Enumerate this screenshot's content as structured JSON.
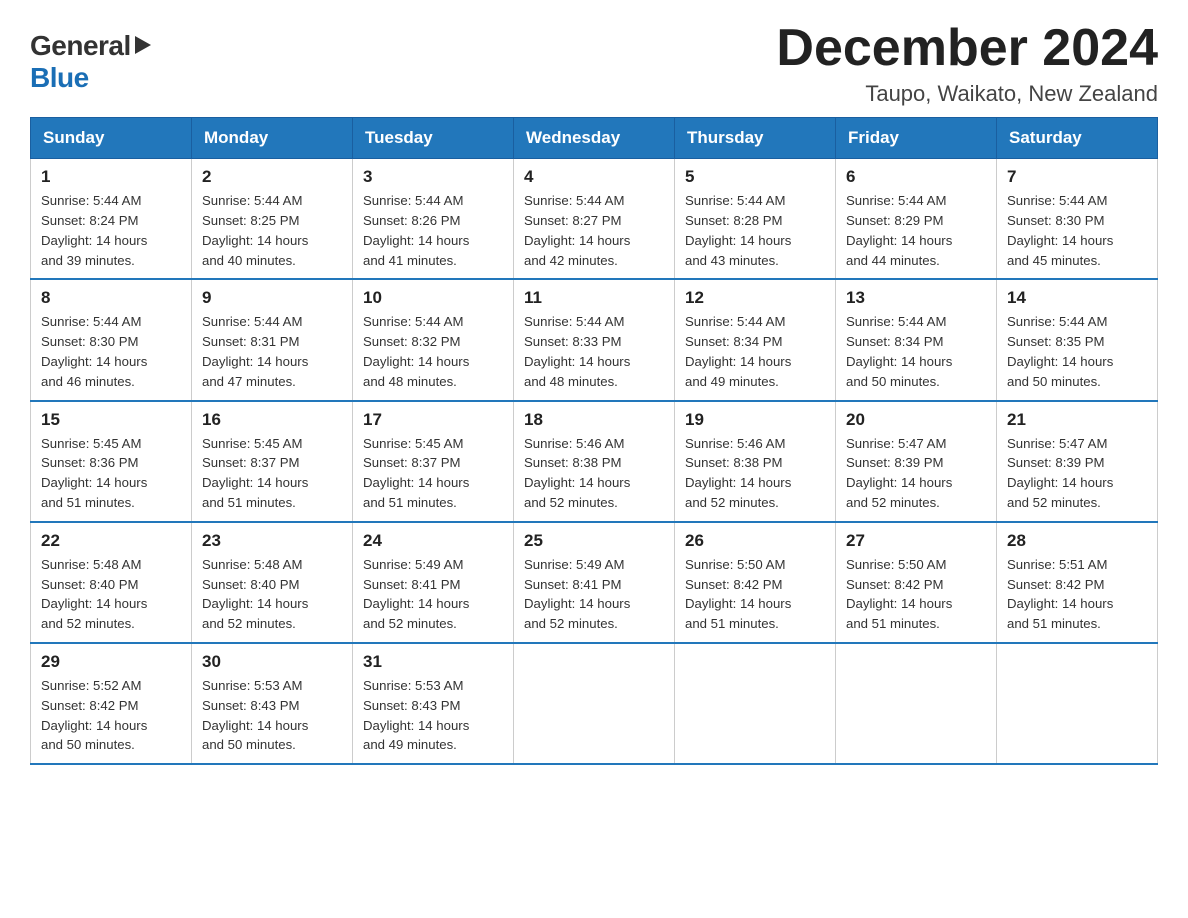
{
  "logo": {
    "general": "General",
    "blue": "Blue"
  },
  "title": {
    "month_year": "December 2024",
    "location": "Taupo, Waikato, New Zealand"
  },
  "headers": [
    "Sunday",
    "Monday",
    "Tuesday",
    "Wednesday",
    "Thursday",
    "Friday",
    "Saturday"
  ],
  "weeks": [
    [
      {
        "day": "1",
        "sunrise": "Sunrise: 5:44 AM",
        "sunset": "Sunset: 8:24 PM",
        "daylight": "Daylight: 14 hours and 39 minutes."
      },
      {
        "day": "2",
        "sunrise": "Sunrise: 5:44 AM",
        "sunset": "Sunset: 8:25 PM",
        "daylight": "Daylight: 14 hours and 40 minutes."
      },
      {
        "day": "3",
        "sunrise": "Sunrise: 5:44 AM",
        "sunset": "Sunset: 8:26 PM",
        "daylight": "Daylight: 14 hours and 41 minutes."
      },
      {
        "day": "4",
        "sunrise": "Sunrise: 5:44 AM",
        "sunset": "Sunset: 8:27 PM",
        "daylight": "Daylight: 14 hours and 42 minutes."
      },
      {
        "day": "5",
        "sunrise": "Sunrise: 5:44 AM",
        "sunset": "Sunset: 8:28 PM",
        "daylight": "Daylight: 14 hours and 43 minutes."
      },
      {
        "day": "6",
        "sunrise": "Sunrise: 5:44 AM",
        "sunset": "Sunset: 8:29 PM",
        "daylight": "Daylight: 14 hours and 44 minutes."
      },
      {
        "day": "7",
        "sunrise": "Sunrise: 5:44 AM",
        "sunset": "Sunset: 8:30 PM",
        "daylight": "Daylight: 14 hours and 45 minutes."
      }
    ],
    [
      {
        "day": "8",
        "sunrise": "Sunrise: 5:44 AM",
        "sunset": "Sunset: 8:30 PM",
        "daylight": "Daylight: 14 hours and 46 minutes."
      },
      {
        "day": "9",
        "sunrise": "Sunrise: 5:44 AM",
        "sunset": "Sunset: 8:31 PM",
        "daylight": "Daylight: 14 hours and 47 minutes."
      },
      {
        "day": "10",
        "sunrise": "Sunrise: 5:44 AM",
        "sunset": "Sunset: 8:32 PM",
        "daylight": "Daylight: 14 hours and 48 minutes."
      },
      {
        "day": "11",
        "sunrise": "Sunrise: 5:44 AM",
        "sunset": "Sunset: 8:33 PM",
        "daylight": "Daylight: 14 hours and 48 minutes."
      },
      {
        "day": "12",
        "sunrise": "Sunrise: 5:44 AM",
        "sunset": "Sunset: 8:34 PM",
        "daylight": "Daylight: 14 hours and 49 minutes."
      },
      {
        "day": "13",
        "sunrise": "Sunrise: 5:44 AM",
        "sunset": "Sunset: 8:34 PM",
        "daylight": "Daylight: 14 hours and 50 minutes."
      },
      {
        "day": "14",
        "sunrise": "Sunrise: 5:44 AM",
        "sunset": "Sunset: 8:35 PM",
        "daylight": "Daylight: 14 hours and 50 minutes."
      }
    ],
    [
      {
        "day": "15",
        "sunrise": "Sunrise: 5:45 AM",
        "sunset": "Sunset: 8:36 PM",
        "daylight": "Daylight: 14 hours and 51 minutes."
      },
      {
        "day": "16",
        "sunrise": "Sunrise: 5:45 AM",
        "sunset": "Sunset: 8:37 PM",
        "daylight": "Daylight: 14 hours and 51 minutes."
      },
      {
        "day": "17",
        "sunrise": "Sunrise: 5:45 AM",
        "sunset": "Sunset: 8:37 PM",
        "daylight": "Daylight: 14 hours and 51 minutes."
      },
      {
        "day": "18",
        "sunrise": "Sunrise: 5:46 AM",
        "sunset": "Sunset: 8:38 PM",
        "daylight": "Daylight: 14 hours and 52 minutes."
      },
      {
        "day": "19",
        "sunrise": "Sunrise: 5:46 AM",
        "sunset": "Sunset: 8:38 PM",
        "daylight": "Daylight: 14 hours and 52 minutes."
      },
      {
        "day": "20",
        "sunrise": "Sunrise: 5:47 AM",
        "sunset": "Sunset: 8:39 PM",
        "daylight": "Daylight: 14 hours and 52 minutes."
      },
      {
        "day": "21",
        "sunrise": "Sunrise: 5:47 AM",
        "sunset": "Sunset: 8:39 PM",
        "daylight": "Daylight: 14 hours and 52 minutes."
      }
    ],
    [
      {
        "day": "22",
        "sunrise": "Sunrise: 5:48 AM",
        "sunset": "Sunset: 8:40 PM",
        "daylight": "Daylight: 14 hours and 52 minutes."
      },
      {
        "day": "23",
        "sunrise": "Sunrise: 5:48 AM",
        "sunset": "Sunset: 8:40 PM",
        "daylight": "Daylight: 14 hours and 52 minutes."
      },
      {
        "day": "24",
        "sunrise": "Sunrise: 5:49 AM",
        "sunset": "Sunset: 8:41 PM",
        "daylight": "Daylight: 14 hours and 52 minutes."
      },
      {
        "day": "25",
        "sunrise": "Sunrise: 5:49 AM",
        "sunset": "Sunset: 8:41 PM",
        "daylight": "Daylight: 14 hours and 52 minutes."
      },
      {
        "day": "26",
        "sunrise": "Sunrise: 5:50 AM",
        "sunset": "Sunset: 8:42 PM",
        "daylight": "Daylight: 14 hours and 51 minutes."
      },
      {
        "day": "27",
        "sunrise": "Sunrise: 5:50 AM",
        "sunset": "Sunset: 8:42 PM",
        "daylight": "Daylight: 14 hours and 51 minutes."
      },
      {
        "day": "28",
        "sunrise": "Sunrise: 5:51 AM",
        "sunset": "Sunset: 8:42 PM",
        "daylight": "Daylight: 14 hours and 51 minutes."
      }
    ],
    [
      {
        "day": "29",
        "sunrise": "Sunrise: 5:52 AM",
        "sunset": "Sunset: 8:42 PM",
        "daylight": "Daylight: 14 hours and 50 minutes."
      },
      {
        "day": "30",
        "sunrise": "Sunrise: 5:53 AM",
        "sunset": "Sunset: 8:43 PM",
        "daylight": "Daylight: 14 hours and 50 minutes."
      },
      {
        "day": "31",
        "sunrise": "Sunrise: 5:53 AM",
        "sunset": "Sunset: 8:43 PM",
        "daylight": "Daylight: 14 hours and 49 minutes."
      },
      null,
      null,
      null,
      null
    ]
  ]
}
